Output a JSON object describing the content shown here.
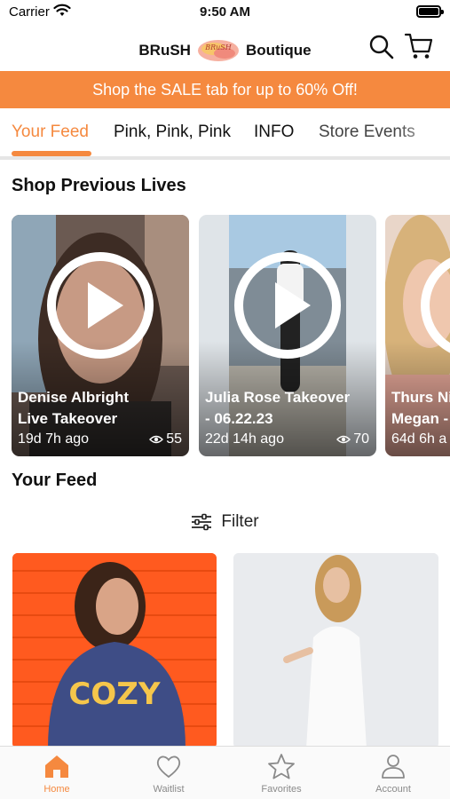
{
  "status_bar": {
    "carrier": "Carrier",
    "time": "9:50 AM"
  },
  "header": {
    "brand_left": "BRuSH",
    "brand_right": "Boutique",
    "logo_script": "BRuSH"
  },
  "promo": {
    "text": "Shop the SALE tab for up to 60% Off!"
  },
  "tabs": [
    {
      "label": "Your Feed",
      "active": true
    },
    {
      "label": "Pink, Pink, Pink",
      "active": false
    },
    {
      "label": "INFO",
      "active": false
    },
    {
      "label": "Store Events",
      "active": false
    }
  ],
  "previous_lives": {
    "title": "Shop Previous Lives",
    "items": [
      {
        "title": "Denise Albright\nLive Takeover",
        "ago": "19d 7h ago",
        "views": "55"
      },
      {
        "title": "Julia Rose Takeover\n- 06.22.23",
        "ago": "22d 14h ago",
        "views": "70"
      },
      {
        "title": "Thurs Ni\nMegan -",
        "ago": "64d 6h a",
        "views": ""
      }
    ]
  },
  "feed": {
    "title": "Your Feed",
    "filter_label": "Filter",
    "product_1_graphic": "COZY"
  },
  "bottom_nav": [
    {
      "label": "Home",
      "active": true
    },
    {
      "label": "Waitlist",
      "active": false
    },
    {
      "label": "Favorites",
      "active": false
    },
    {
      "label": "Account",
      "active": false
    }
  ],
  "colors": {
    "accent": "#f5893f",
    "promo_bg": "#f5893f"
  }
}
